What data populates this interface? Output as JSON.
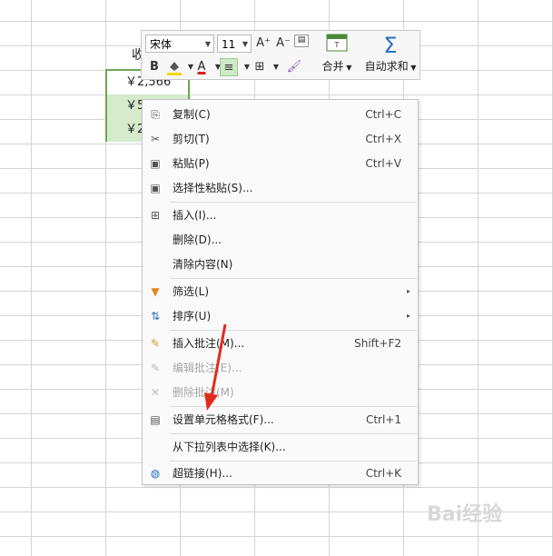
{
  "sheet": {
    "header_partial": "收",
    "cells": [
      "￥2,566",
      "￥5",
      "￥2"
    ]
  },
  "minibar": {
    "font_name": "宋体",
    "font_size": "11",
    "increase_font_icon": "A⁺",
    "decrease_font_icon": "A⁻",
    "bold": "B",
    "font_color_letter": "A",
    "merge_label": "合并",
    "autosum_label": "自动求和",
    "sigma": "Σ",
    "colors": {
      "highlight": "#f2d600",
      "font": "#d9201b",
      "selected": "#d5ebcc"
    }
  },
  "context_menu": {
    "items": [
      {
        "label": "复制(C)",
        "shortcut": "Ctrl+C",
        "icon": "copy-icon",
        "glyph": "⎘"
      },
      {
        "label": "剪切(T)",
        "shortcut": "Ctrl+X",
        "icon": "scissors-icon",
        "glyph": "✂"
      },
      {
        "label": "粘贴(P)",
        "shortcut": "Ctrl+V",
        "icon": "paste-icon",
        "glyph": "📋"
      },
      {
        "label": "选择性粘贴(S)...",
        "shortcut": "",
        "icon": "paste-special-icon",
        "glyph": "📋"
      },
      {
        "label": "插入(I)...",
        "shortcut": "",
        "icon": "insert-icon",
        "glyph": "⊞"
      },
      {
        "label": "删除(D)...",
        "shortcut": "",
        "icon": "",
        "glyph": ""
      },
      {
        "label": "清除内容(N)",
        "shortcut": "",
        "icon": "",
        "glyph": ""
      },
      {
        "label": "筛选(L)",
        "shortcut": "",
        "icon": "filter-icon",
        "glyph": "▼"
      },
      {
        "label": "排序(U)",
        "shortcut": "",
        "icon": "sort-icon",
        "glyph": "⇅"
      },
      {
        "label": "插入批注(M)...",
        "shortcut": "Shift+F2",
        "icon": "insert-comment-icon",
        "glyph": "✎"
      },
      {
        "label": "编辑批注(E)...",
        "shortcut": "",
        "icon": "edit-comment-icon",
        "glyph": "✎"
      },
      {
        "label": "删除批注(M)",
        "shortcut": "",
        "icon": "delete-comment-icon",
        "glyph": "✕"
      },
      {
        "label": "设置单元格格式(F)...",
        "shortcut": "Ctrl+1",
        "icon": "format-cells-icon",
        "glyph": "▤"
      },
      {
        "label": "从下拉列表中选择(K)...",
        "shortcut": "",
        "icon": "",
        "glyph": ""
      },
      {
        "label": "超链接(H)...",
        "shortcut": "Ctrl+K",
        "icon": "hyperlink-icon",
        "glyph": "🌐"
      }
    ],
    "submenu_marker": "▸"
  },
  "watermark": {
    "text": "Bai经验"
  }
}
